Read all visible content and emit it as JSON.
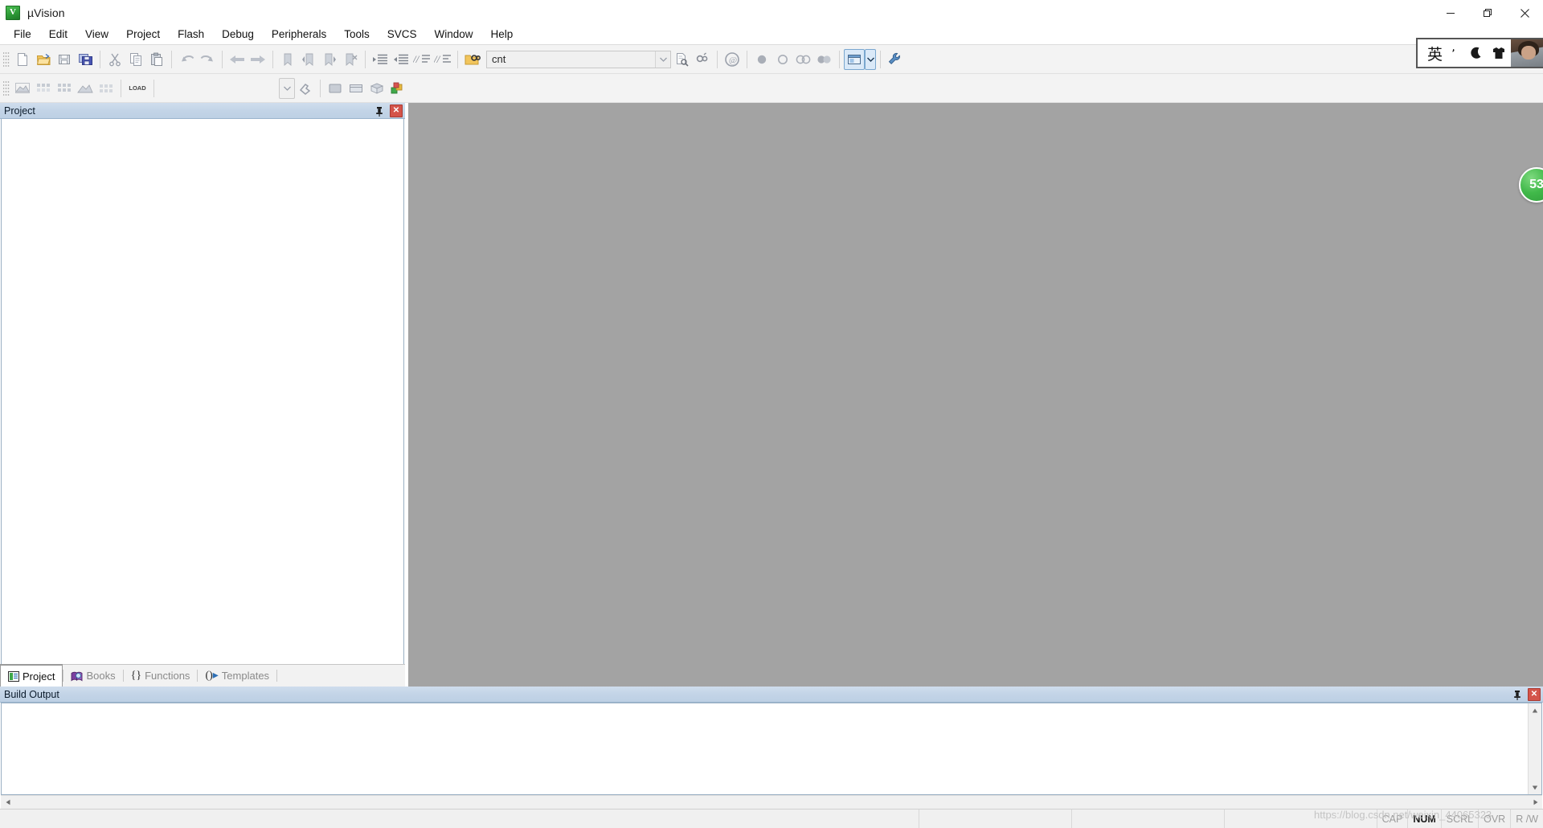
{
  "window": {
    "title": "µVision",
    "app_icon": "keil-uvision-icon",
    "minimize_label": "Minimize",
    "maximize_label": "Restore",
    "close_label": "Close"
  },
  "menu": {
    "items": [
      {
        "label": "File",
        "name": "menu-file"
      },
      {
        "label": "Edit",
        "name": "menu-edit"
      },
      {
        "label": "View",
        "name": "menu-view"
      },
      {
        "label": "Project",
        "name": "menu-project"
      },
      {
        "label": "Flash",
        "name": "menu-flash"
      },
      {
        "label": "Debug",
        "name": "menu-debug"
      },
      {
        "label": "Peripherals",
        "name": "menu-peripherals"
      },
      {
        "label": "Tools",
        "name": "menu-tools"
      },
      {
        "label": "SVCS",
        "name": "menu-svcs"
      },
      {
        "label": "Window",
        "name": "menu-window"
      },
      {
        "label": "Help",
        "name": "menu-help"
      }
    ]
  },
  "toolbar_file": {
    "buttons": [
      {
        "name": "new-file-icon",
        "title": "New"
      },
      {
        "name": "open-file-icon",
        "title": "Open"
      },
      {
        "name": "save-icon",
        "title": "Save"
      },
      {
        "name": "save-all-icon",
        "title": "Save All"
      },
      {
        "name": "cut-icon",
        "title": "Cut"
      },
      {
        "name": "copy-icon",
        "title": "Copy"
      },
      {
        "name": "paste-icon",
        "title": "Paste"
      },
      {
        "name": "undo-icon",
        "title": "Undo"
      },
      {
        "name": "redo-icon",
        "title": "Redo"
      },
      {
        "name": "navigate-backward-icon",
        "title": "Back"
      },
      {
        "name": "navigate-forward-icon",
        "title": "Forward"
      },
      {
        "name": "bookmark-toggle-icon",
        "title": "Insert/Remove Bookmark"
      },
      {
        "name": "bookmark-prev-icon",
        "title": "Go to Previous Bookmark"
      },
      {
        "name": "bookmark-next-icon",
        "title": "Go to Next Bookmark"
      },
      {
        "name": "bookmark-clear-icon",
        "title": "Clear All Bookmarks"
      },
      {
        "name": "indent-right-icon",
        "title": "Indent Selected Text"
      },
      {
        "name": "indent-left-icon",
        "title": "Unindent Selected Text"
      },
      {
        "name": "comment-icon",
        "title": "Comment Selection"
      },
      {
        "name": "uncomment-icon",
        "title": "Uncomment Selection"
      },
      {
        "name": "find-in-files-icon",
        "title": "Find in Files"
      }
    ],
    "find": {
      "value": "cnt",
      "placeholder": "",
      "dropdown_name": "find-history-dropdown"
    },
    "after_find": [
      {
        "name": "find-next-icon",
        "title": "Find Next"
      },
      {
        "name": "incremental-find-icon",
        "title": "Incremental Find"
      },
      {
        "name": "browse-symbols-icon",
        "title": "Browse Symbols"
      },
      {
        "name": "start-debug-icon",
        "title": "Start/Stop Debug Session"
      },
      {
        "name": "insert-breakpoint-icon",
        "title": "Insert/Remove Breakpoint"
      },
      {
        "name": "disable-breakpoint-icon",
        "title": "Enable/Disable Breakpoint"
      },
      {
        "name": "disable-all-breakpoints-icon",
        "title": "Disable All Breakpoints"
      },
      {
        "name": "kill-all-breakpoints-icon",
        "title": "Kill All Breakpoints"
      },
      {
        "name": "manage-windows-icon",
        "title": "Manage Component Windows"
      },
      {
        "name": "manage-windows-dropdown",
        "title": "Window Layout Dropdown"
      },
      {
        "name": "configure-icon",
        "title": "Configuration Wizard"
      }
    ]
  },
  "toolbar_build": {
    "buttons": [
      {
        "name": "translate-file-icon",
        "title": "Translate Current File"
      },
      {
        "name": "build-target-icon",
        "title": "Build Target"
      },
      {
        "name": "rebuild-all-icon",
        "title": "Rebuild All Target Files"
      },
      {
        "name": "batch-build-icon",
        "title": "Batch Build"
      },
      {
        "name": "stop-build-icon",
        "title": "Stop Build"
      },
      {
        "name": "download-icon",
        "title": "Download",
        "label": "LOAD"
      }
    ],
    "target_select": {
      "name": "target-selector",
      "value": "",
      "dropdown_name": "target-dropdown"
    },
    "right_buttons": [
      {
        "name": "target-options-icon",
        "title": "Options for Target"
      },
      {
        "name": "manage-project-items-icon",
        "title": "Manage Project Items"
      },
      {
        "name": "run-to-main-icon",
        "title": "Run to main"
      },
      {
        "name": "pack-installer-icon",
        "title": "Pack Installer"
      },
      {
        "name": "manage-run-environment-icon",
        "title": "Manage Run-Time Environment"
      }
    ]
  },
  "project_panel": {
    "title": "Project",
    "pin_name": "auto-hide-pin",
    "close_name": "close-panel",
    "tree_items": [],
    "tabs": [
      {
        "label": "Project",
        "icon": "project-tab-icon",
        "active": true
      },
      {
        "label": "Books",
        "icon": "books-tab-icon",
        "active": false
      },
      {
        "label": "Functions",
        "icon": "functions-tab-icon",
        "active": false
      },
      {
        "label": "Templates",
        "icon": "templates-tab-icon",
        "active": false
      }
    ]
  },
  "editor_area": {
    "background_color": "#a3a3a3",
    "open_documents": []
  },
  "build_output": {
    "title": "Build Output",
    "pin_name": "auto-hide-pin",
    "close_name": "close-panel",
    "text": ""
  },
  "status_bar": {
    "message": "",
    "cells": [
      {
        "label": "",
        "name": "status-cell-blank-1",
        "dim": false,
        "wide": true
      },
      {
        "label": "",
        "name": "status-cell-blank-2",
        "dim": false,
        "wide": true
      },
      {
        "label": "",
        "name": "status-cell-blank-3",
        "dim": false,
        "wide": true
      }
    ],
    "indicators": [
      {
        "label": "CAP",
        "name": "caps-lock-indicator",
        "active": false
      },
      {
        "label": "NUM",
        "name": "num-lock-indicator",
        "active": true
      },
      {
        "label": "SCRL",
        "name": "scroll-lock-indicator",
        "active": false
      },
      {
        "label": "OVR",
        "name": "overwrite-indicator",
        "active": false
      },
      {
        "label": "R /W",
        "name": "readwrite-indicator",
        "active": false
      }
    ]
  },
  "overlays": {
    "ime_bar": {
      "mode_label": "英",
      "icons": [
        "punctuation-icon",
        "moon-icon",
        "skin-icon"
      ],
      "avatar_name": "user-avatar"
    },
    "notification_badge": {
      "count": "53"
    },
    "watermark": {
      "text": "https://blog.csdn.net/weixin_44065323"
    }
  },
  "colors": {
    "caption_bar": "#c3d4e7",
    "mdi_background": "#a3a3a3",
    "toolbar_bg": "#f3f3f3",
    "close_red": "#d4544a",
    "badge_green": "#41b94a"
  }
}
